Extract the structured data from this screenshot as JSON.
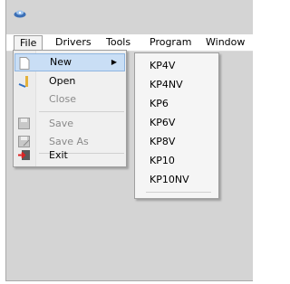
{
  "menubar": {
    "file": "File",
    "drivers": "Drivers",
    "tools": "Tools",
    "program": "Program",
    "window": "Window"
  },
  "file_menu": {
    "new": "New",
    "open": "Open",
    "close": "Close",
    "save": "Save",
    "save_as": "Save As",
    "exit": "Exit"
  },
  "new_submenu": [
    "KP4V",
    "KP4NV",
    "KP6",
    "KP6V",
    "KP8V",
    "KP10",
    "KP10NV"
  ],
  "colors": {
    "highlight": "#c9def5",
    "disabled_text": "#8a8a8a"
  }
}
